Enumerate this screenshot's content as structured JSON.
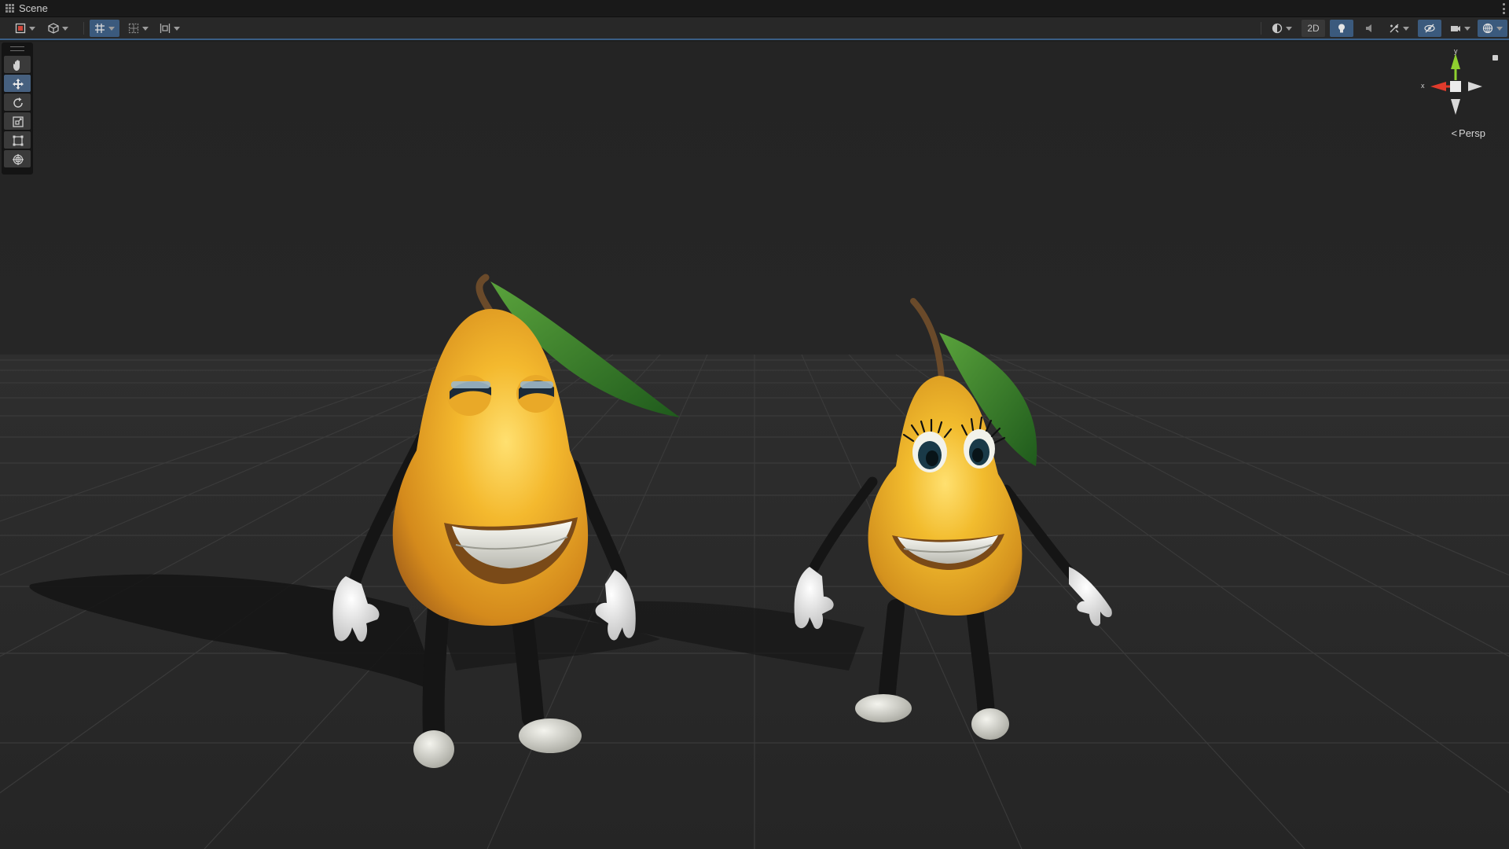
{
  "window": {
    "tab_title": "Scene",
    "grid_icon": "grid-icon",
    "more_icon": "kebab-icon"
  },
  "toolbar": {
    "left_tools": [
      {
        "name": "draw-mode-dropdown",
        "icon": "render-mode-icon"
      },
      {
        "name": "shading-dropdown",
        "icon": "cube-icon"
      },
      {
        "name": "grid-snap-dropdown",
        "icon": "grid-snap-icon"
      },
      {
        "name": "incremental-snap-dropdown",
        "icon": "snap-icon"
      },
      {
        "name": "align-dropdown",
        "icon": "align-icon"
      }
    ],
    "toggle_2d_label": "2D",
    "right_tools": [
      {
        "name": "draw-shading-dropdown",
        "icon": "sphere-icon"
      },
      {
        "name": "2d-toggle",
        "icon": "2d"
      },
      {
        "name": "lighting-toggle",
        "icon": "lightbulb-icon"
      },
      {
        "name": "audio-toggle",
        "icon": "speaker-icon"
      },
      {
        "name": "effects-dropdown",
        "icon": "effects-icon"
      },
      {
        "name": "scene-visibility-toggle",
        "icon": "eye-slash-icon"
      },
      {
        "name": "camera-dropdown",
        "icon": "camera-icon"
      },
      {
        "name": "gizmos-dropdown",
        "icon": "globe-icon"
      }
    ]
  },
  "tool_palette": {
    "tools": [
      {
        "name": "view-tool",
        "icon": "hand-icon"
      },
      {
        "name": "move-tool",
        "icon": "move-arrows-icon",
        "active": true
      },
      {
        "name": "rotate-tool",
        "icon": "rotate-icon"
      },
      {
        "name": "scale-tool",
        "icon": "scale-icon"
      },
      {
        "name": "rect-tool",
        "icon": "rect-transform-icon"
      },
      {
        "name": "transform-tool",
        "icon": "transform-icon"
      }
    ]
  },
  "gizmo": {
    "y_label": "y",
    "x_label": "x",
    "projection_label": "Persp",
    "colors": {
      "x": "#e03b2c",
      "y": "#8fd12f",
      "z": "#e8e8e8"
    }
  },
  "scene": {
    "background_color": "#232323",
    "floor_color": "#2b2b2b",
    "grid_color": "#3a3a3a",
    "pear_color": "#f0b72b",
    "leaf_color": "#2f7a25"
  }
}
